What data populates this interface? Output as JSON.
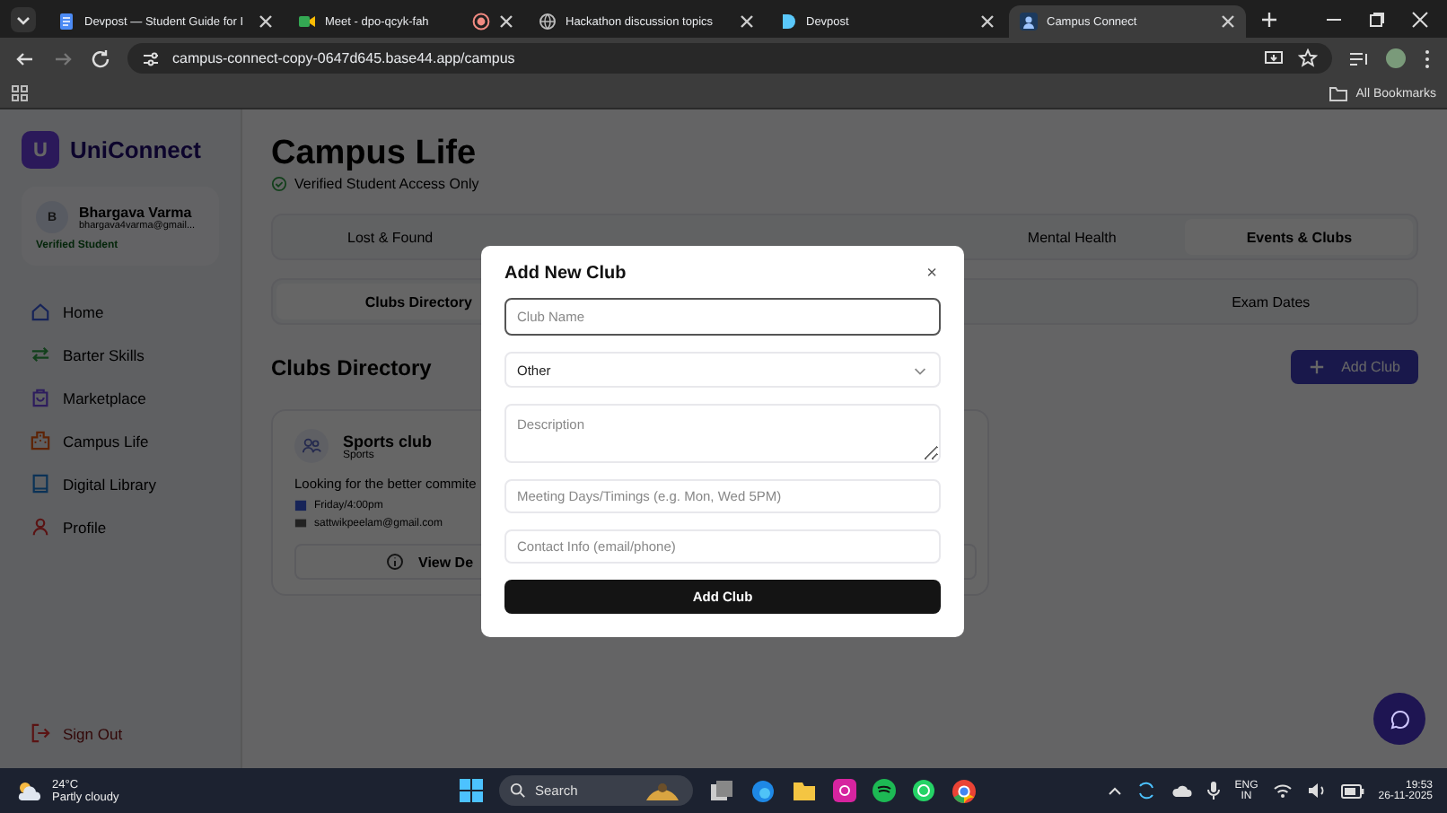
{
  "browser": {
    "tabs": [
      {
        "title": "Devpost — Student Guide for I",
        "kind": "document",
        "recording": false,
        "selected": false
      },
      {
        "title": "Meet - dpo-qcyk-fah",
        "kind": "meet",
        "recording": true,
        "selected": false
      },
      {
        "title": "Hackathon discussion topics",
        "kind": "globe",
        "recording": false,
        "selected": false
      },
      {
        "title": "Devpost",
        "kind": "letter",
        "recording": false,
        "selected": false
      },
      {
        "title": "Campus Connect",
        "kind": "app",
        "recording": false,
        "selected": true
      }
    ],
    "address": "campus-connect-copy-0647d645.base44.app/campus",
    "bookmarks": "All Bookmarks"
  },
  "sidebar": {
    "logo_letter": "U",
    "brand": "UniConnect",
    "user": {
      "initial": "B",
      "name": "Bhargava Varma",
      "email": "bhargava4varma@gmail...",
      "badge": "Verified Student"
    },
    "nav": [
      {
        "label": "Home",
        "kind": "home"
      },
      {
        "label": "Barter Skills",
        "kind": "swap"
      },
      {
        "label": "Marketplace",
        "kind": "bag"
      },
      {
        "label": "Campus Life",
        "kind": "building"
      },
      {
        "label": "Digital Library",
        "kind": "book"
      },
      {
        "label": "Profile",
        "kind": "user"
      }
    ],
    "sign_out": "Sign Out"
  },
  "main": {
    "title": "Campus Life",
    "subtitle": "Verified Student Access Only",
    "tab_rows": [
      [
        {
          "label": "Lost & Found",
          "selected": false
        },
        {
          "label": "Mental Health",
          "selected": false
        },
        {
          "label": "Events & Clubs",
          "selected": true
        }
      ],
      [
        {
          "label": "Clubs Directory",
          "selected": true
        },
        {
          "label": "Exam Dates",
          "selected": false
        }
      ]
    ],
    "section_title": "Clubs Directory",
    "add_button": "Add Club",
    "clubs": [
      {
        "name": "Sports club",
        "category": "Sports",
        "description": "Looking for the better commite",
        "schedule": "Friday/4:00pm",
        "contact": "sattwikpeelam@gmail.com",
        "details_button": "View De"
      }
    ]
  },
  "modal": {
    "title": "Add New Club",
    "close": "×",
    "fields": [
      {
        "kind": "text",
        "placeholder": "Club Name",
        "focused": true
      },
      {
        "kind": "select",
        "value": "Other",
        "focused": false
      },
      {
        "kind": "textarea",
        "placeholder": "Description",
        "focused": false
      },
      {
        "kind": "text",
        "placeholder": "Meeting Days/Timings (e.g. Mon, Wed 5PM)",
        "focused": false
      },
      {
        "kind": "text",
        "placeholder": "Contact Info (email/phone)",
        "focused": false
      }
    ],
    "submit": "Add Club"
  },
  "taskbar": {
    "temperature": "24°C",
    "condition": "Partly cloudy",
    "search": "Search",
    "language": "ENG",
    "region": "IN",
    "time": "19:53",
    "date": "26-11-2025"
  }
}
